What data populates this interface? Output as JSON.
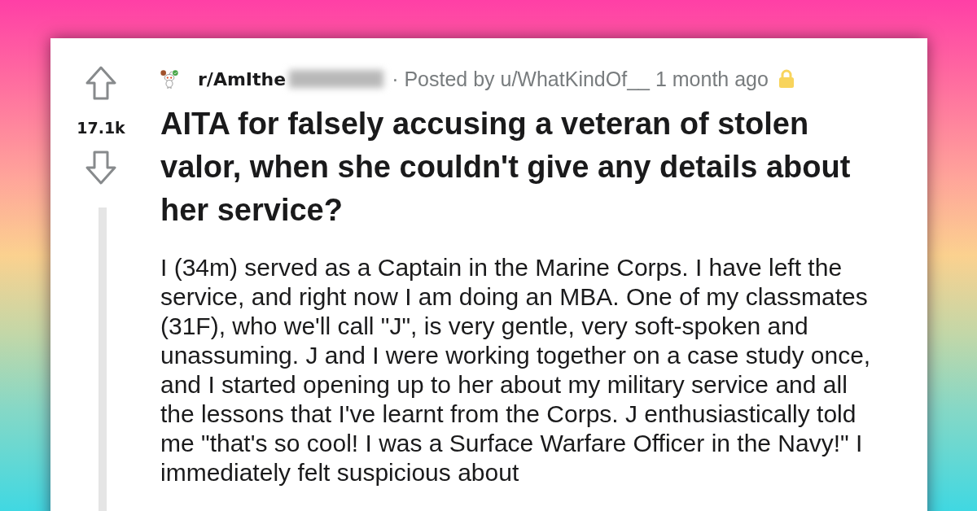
{
  "post": {
    "vote_count": "17.1k",
    "subreddit": "r/AmIthe",
    "subreddit_blurred": true,
    "meta": "· Posted by u/WhatKindOf__ 1 month ago",
    "locked": true,
    "title": "AITA for falsely accusing a veteran of stolen valor, when she couldn't give any details about her service?",
    "body": "I (34m) served as a Captain in the Marine Corps. I have left the service, and right now I am doing an MBA. One of my classmates (31F), who we'll call \"J\", is very gentle, very soft-spoken and unassuming. J and I were working together on a case study once, and I started opening up to her about my military service and all the lessons that I've learnt from the Corps. J enthusiastically told me \"that's so cool! I was a Surface Warfare Officer in the Navy!\" I immediately felt suspicious about"
  }
}
